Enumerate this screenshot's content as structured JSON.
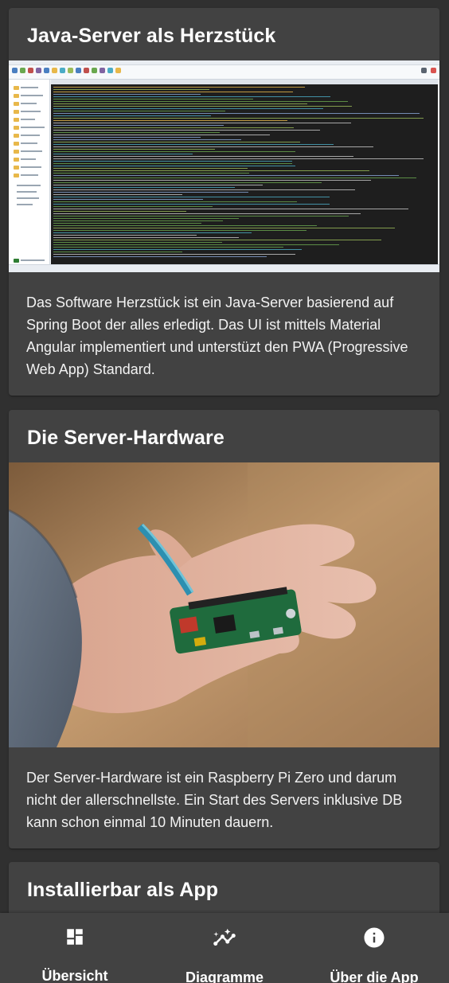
{
  "cards": [
    {
      "title": "Java-Server als Herzstück",
      "text": "Das Software Herzstück ist ein Java-Server basierend auf Spring Boot der alles erledigt. Das UI ist mittels Material Angular implementiert und unterstüzt den PWA (Progressive Web App) Standard.",
      "image": "ide-console-screenshot"
    },
    {
      "title": "Die Server-Hardware",
      "text": "Der Server-Hardware ist ein Raspberry Pi Zero und darum nicht der allerschnellste. Ein Start des Servers inklusive DB kann schon einmal 10 Minuten dauern.",
      "image": "raspberry-pi-zero-in-hand-photo"
    },
    {
      "title": "Installierbar als App"
    }
  ],
  "nav": {
    "items": [
      {
        "label": "Übersicht",
        "icon": "dashboard-icon"
      },
      {
        "label": "Diagramme",
        "icon": "insights-chart-icon"
      },
      {
        "label": "Über die App",
        "icon": "info-icon"
      }
    ]
  },
  "colors": {
    "background": "#303030",
    "card": "#424242",
    "nav": "#424242",
    "text": "#ffffff"
  }
}
